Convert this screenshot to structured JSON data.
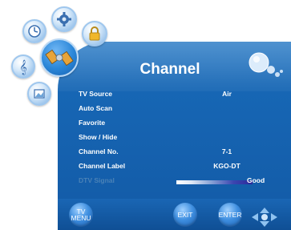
{
  "header": {
    "title": "Channel"
  },
  "menu": {
    "items": [
      {
        "label": "TV Source",
        "value": "Air"
      },
      {
        "label": "Auto Scan",
        "value": ""
      },
      {
        "label": "Favorite",
        "value": ""
      },
      {
        "label": "Show / Hide",
        "value": ""
      },
      {
        "label": "Channel No.",
        "value": "7-1"
      },
      {
        "label": "Channel Label",
        "value": "KGO-DT"
      },
      {
        "label": "DTV Signal",
        "value": "Good",
        "signal_level": 0.82,
        "disabled": true
      }
    ]
  },
  "footer": {
    "menu_button": {
      "line1": "TV",
      "line2": "MENU"
    },
    "exit_button": "EXIT",
    "enter_button": "ENTER",
    "nav_icon": "dpad-icon"
  },
  "side_icons": [
    "gear-icon",
    "clock-icon",
    "lock-icon",
    "satellite-icon",
    "music-note-icon",
    "picture-icon"
  ],
  "colors": {
    "panel": "#1767b5",
    "text": "#ffffff",
    "disabled": "#4a82b7"
  }
}
